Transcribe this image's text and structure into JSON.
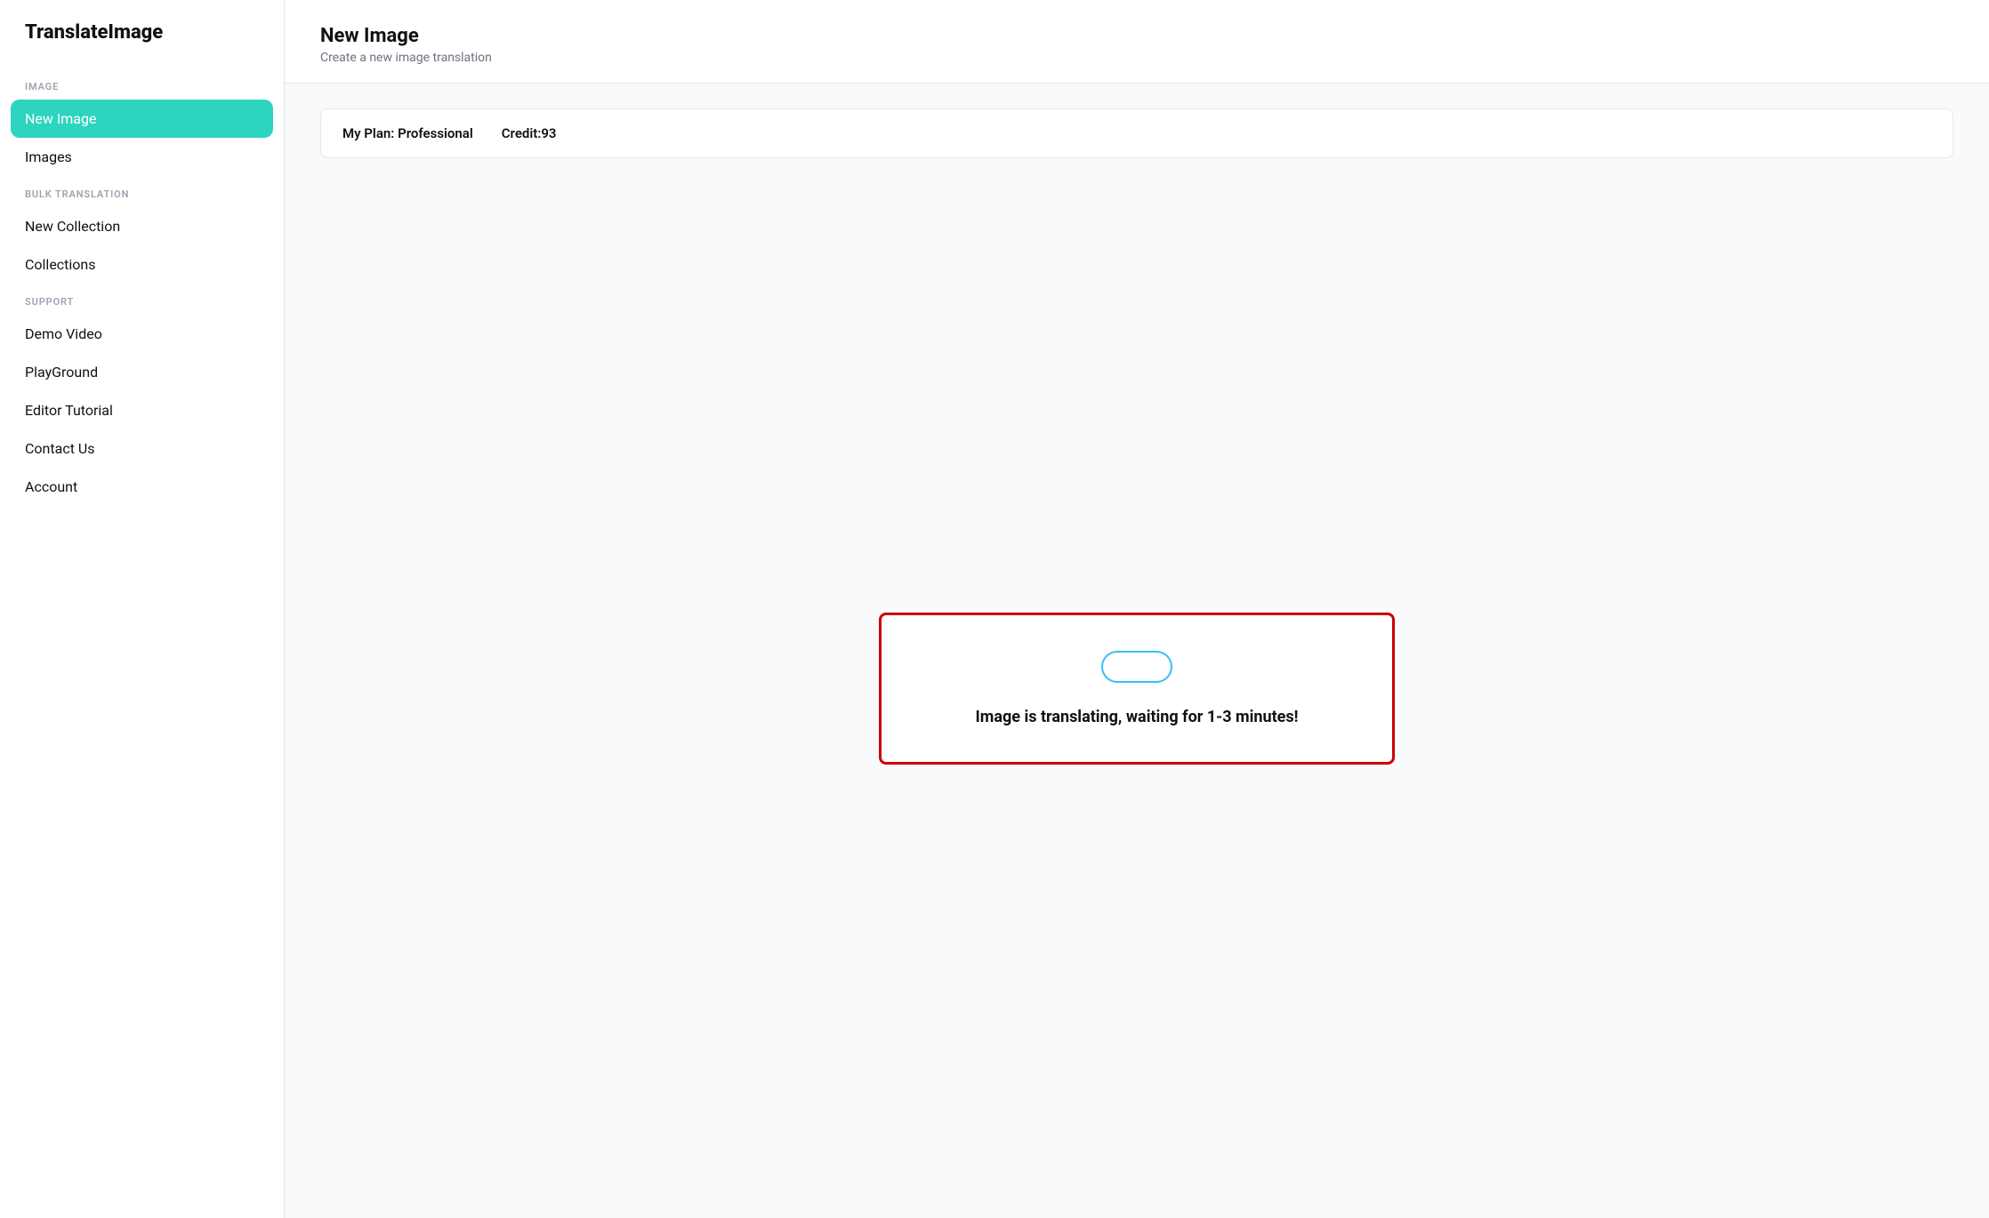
{
  "app": {
    "logo": "TranslateImage"
  },
  "sidebar": {
    "sections": [
      {
        "label": "IMAGE",
        "items": [
          {
            "id": "new-image",
            "text": "New Image",
            "active": true
          },
          {
            "id": "images",
            "text": "Images",
            "active": false
          }
        ]
      },
      {
        "label": "BULK TRANSLATION",
        "items": [
          {
            "id": "new-collection",
            "text": "New Collection",
            "active": false
          },
          {
            "id": "collections",
            "text": "Collections",
            "active": false
          }
        ]
      },
      {
        "label": "SUPPORT",
        "items": [
          {
            "id": "demo-video",
            "text": "Demo Video",
            "active": false
          },
          {
            "id": "playground",
            "text": "PlayGround",
            "active": false
          },
          {
            "id": "editor-tutorial",
            "text": "Editor Tutorial",
            "active": false
          },
          {
            "id": "contact-us",
            "text": "Contact Us",
            "active": false
          },
          {
            "id": "account",
            "text": "Account",
            "active": false
          }
        ]
      }
    ]
  },
  "header": {
    "title": "New Image",
    "subtitle": "Create a new image translation"
  },
  "plan": {
    "label": "My Plan: Professional",
    "credit_label": "Credit:93"
  },
  "status": {
    "message": "Image is translating, waiting for 1-3 minutes!"
  }
}
